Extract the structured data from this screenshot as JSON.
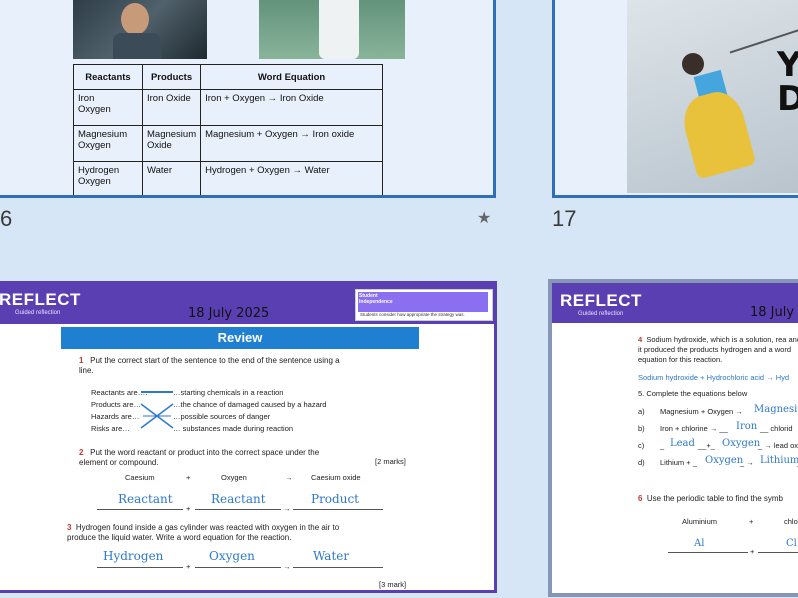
{
  "slide16": {
    "number": "6",
    "table": {
      "headers": [
        "Reactants",
        "Products",
        "Word Equation"
      ],
      "rows": [
        [
          "Iron\nOxygen",
          "Iron Oxide",
          "Iron + Oxygen → Iron Oxide"
        ],
        [
          "Magnesium\nOxygen",
          "Magnesium\nOxide",
          "Magnesium + Oxygen → Iron oxide"
        ],
        [
          "Hydrogen\nOxygen",
          "Water",
          "Hydrogen + Oxygen → Water"
        ]
      ]
    }
  },
  "slide17": {
    "number": "17",
    "banner_text": "YO\nD"
  },
  "slide_review": {
    "header": "REFLECT",
    "subheader": "Guided reflection",
    "date": "18 July 2025",
    "badge_title": "Student\nIndependence",
    "badge_note": "Students consider how appropriate the strategy was.",
    "title": "Review",
    "q1": "Put the correct start of the sentence to the end of the sentence using a line.",
    "q1_left": [
      "Reactants are….",
      "Products are…",
      "Hazards are…",
      "Risks are…"
    ],
    "q1_right": [
      "…starting chemicals in a reaction",
      "…the chance of damaged caused by a hazard",
      "…possible sources of danger",
      "… substances made during reaction"
    ],
    "q2": "Put the word reactant or product into the correct space under the element or compound.",
    "q2_marks": "[2 marks]",
    "q2_terms": [
      "Caesium",
      "+",
      "Oxygen",
      "→",
      "Caesium oxide"
    ],
    "q2_answers": [
      "Reactant",
      "Reactant",
      "Product"
    ],
    "q3": "Hydrogen found inside a gas cylinder was reacted with oxygen in the air to produce the liquid water. Write a word equation for the reaction.",
    "q3_answers": [
      "Hydrogen",
      "Oxygen",
      "Water"
    ],
    "q3_marks": "[3 mark]",
    "plus": "+",
    "arrow": "→",
    "qnums": [
      "1",
      "2",
      "3"
    ]
  },
  "slide_right": {
    "header": "REFLECT",
    "subheader": "Guided reflection",
    "date": "18 July",
    "q4": "Sodium hydroxide, which is a solution, rea and it produced the products hydrogen and a word equation for this reaction.",
    "q4_num": "4",
    "answer_line": "Sodium hydroxide + Hydrochloric acid → Hyd",
    "q5": "5. Complete the equations below",
    "eqs": [
      {
        "label": "a)",
        "text": "Magnesium + Oxygen →",
        "answer": "Magnesium"
      },
      {
        "label": "b)",
        "text": "Iron + chlorine → __",
        "answer": "Iron",
        "tail": "__ chlorid"
      },
      {
        "label": "c)",
        "text": "_",
        "answer": "Lead",
        "mid": "__+_",
        "answer2": "Oxygen",
        "tail": "_ → lead oxi"
      },
      {
        "label": "d)",
        "text": "Lithium + _",
        "answer": "Oxygen",
        "mid": "_ →",
        "answer2": "Lithium",
        "tail": "_"
      }
    ],
    "q6": "Use the periodic table to find the symb",
    "q6_num": "6",
    "q6_terms": [
      "Aluminium",
      "+",
      "chlor"
    ],
    "q6_answers": [
      "Al",
      "Cl"
    ],
    "plus": "+"
  },
  "colors": {
    "accent": "#5a3fb3",
    "border": "#2f6fb8",
    "review_bar": "#1f7fd0",
    "hand": "#2e78c9"
  }
}
